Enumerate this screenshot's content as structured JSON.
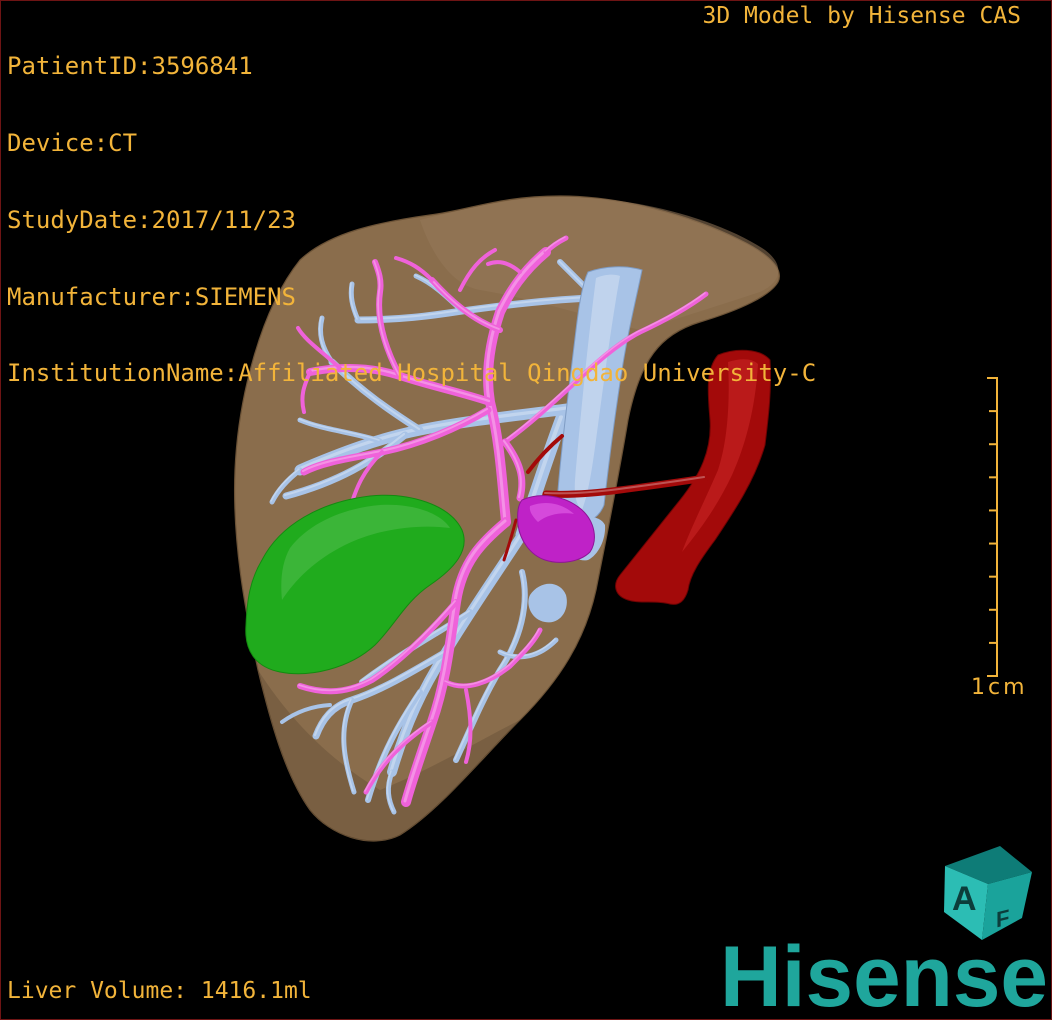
{
  "study_info": [
    {
      "label": "PatientID:",
      "value": "3596841"
    },
    {
      "label": "Device:",
      "value": "CT"
    },
    {
      "label": "StudyDate:",
      "value": "2017/11/23"
    },
    {
      "label": "Manufacturer:",
      "value": "SIEMENS"
    },
    {
      "label": "InstitutionName:",
      "value": "Affiliated Hospital Qingdao University-C"
    }
  ],
  "model_credit": "3D Model by Hisense CAS",
  "scale_bar": {
    "label": "1cm"
  },
  "liver_volume": {
    "label": "Liver Volume:",
    "value": "1416.1ml"
  },
  "logo": {
    "wordmark": "Hisense",
    "cube_letters": [
      "A",
      "F"
    ]
  },
  "colors": {
    "overlay_text": "#f2b43a",
    "brand": "#1fa69c",
    "background": "#000000",
    "frame": "#6e1414",
    "liver": "#8a6d4c",
    "liver_highlight": "#95785a",
    "vessel_pink": "#ef62da",
    "vessel_blue": "#a8c3e7",
    "green_structure": "#20ab1d",
    "purple_structure": "#bf22c7",
    "red_vessel": "#a30a0a"
  }
}
